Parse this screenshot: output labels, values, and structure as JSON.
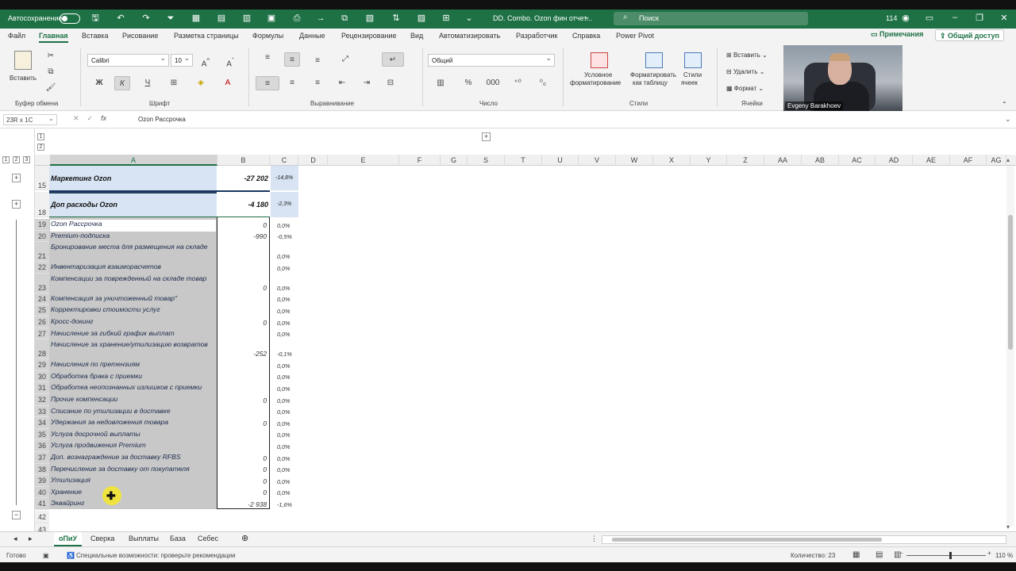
{
  "titlebar": {
    "autosave_label": "Автосохранение",
    "file_name": "DD. Combo. Ozon фин отчет...",
    "search_placeholder": "Поиск",
    "user_count": "114"
  },
  "ribbon_tabs": [
    "Файл",
    "Главная",
    "Вставка",
    "Рисование",
    "Разметка страницы",
    "Формулы",
    "Данные",
    "Рецензирование",
    "Вид",
    "Автоматизировать",
    "Разработчик",
    "Справка",
    "Power Pivot"
  ],
  "ribbon_right": {
    "notes": "Примечания",
    "share": "Общий доступ"
  },
  "ribbon": {
    "paste": "Вставить",
    "clipboard": "Буфер обмена",
    "font_name": "Calibri",
    "font_size": "10",
    "font_group": "Шрифт",
    "bold": "Ж",
    "italic": "К",
    "underline": "Ч",
    "alignment_group": "Выравнивание",
    "number_format": "Общий",
    "number_group": "Число",
    "cond_format_1": "Условное",
    "cond_format_2": "форматирование",
    "format_table_1": "Форматировать",
    "format_table_2": "как таблицу",
    "styles_1": "Стили",
    "styles_2": "ячеек",
    "styles_group": "Стили",
    "insert_cells": "Вставить",
    "delete_cells": "Удалить",
    "format_cells": "Формат",
    "cells_group": "Ячейки"
  },
  "video": {
    "name": "Evgeny Barakhoev"
  },
  "formula_bar": {
    "name_box": "23R x 1C",
    "fx": "fx",
    "value": "Ozon Рассрочка"
  },
  "outline_levels": [
    "1",
    "2",
    "3"
  ],
  "column_headers": [
    "A",
    "B",
    "C",
    "D",
    "E",
    "F",
    "G",
    "S",
    "T",
    "U",
    "V",
    "W",
    "X",
    "Y",
    "Z",
    "AA",
    "AB",
    "AC",
    "AD",
    "AE",
    "AF",
    "AG"
  ],
  "header_rows": [
    {
      "row": "15",
      "label": "Маркетинг Ozon",
      "b": "-27 202",
      "c": "-14,8%"
    },
    {
      "row": "18",
      "label": "Доп расходы Ozon",
      "b": "-4 180",
      "c": "-2,3%"
    }
  ],
  "rows": [
    {
      "row": "19",
      "label": "Ozon Рассрочка",
      "b": "0",
      "c": "0,0%"
    },
    {
      "row": "20",
      "label": "Premium-подписка",
      "b": "-990",
      "c": "-0,5%"
    },
    {
      "row": "21",
      "label": "Бронирование места для размещения на складе",
      "b": "",
      "c": "0,0%"
    },
    {
      "row": "22",
      "label": "Инвентаризация взаиморасчетов",
      "b": "",
      "c": "0,0%"
    },
    {
      "row": "23",
      "label": "Компенсации за поврежденный на складе товар",
      "b": "0",
      "c": "0,0%"
    },
    {
      "row": "24",
      "label": "Компенсация за уничтоженный товар\"",
      "b": "",
      "c": "0,0%"
    },
    {
      "row": "25",
      "label": "Корректировки стоимости услуг",
      "b": "",
      "c": "0,0%"
    },
    {
      "row": "26",
      "label": "Кросс-докинг",
      "b": "0",
      "c": "0,0%"
    },
    {
      "row": "27",
      "label": "Начисление за гибкий график выплат",
      "b": "",
      "c": "0,0%"
    },
    {
      "row": "28",
      "label": "Начисление за хранение/утилизацию возвратов",
      "b": "-252",
      "c": "-0,1%"
    },
    {
      "row": "29",
      "label": "Начисления по претензиям",
      "b": "",
      "c": "0,0%"
    },
    {
      "row": "30",
      "label": "Обработка брака с приемки",
      "b": "",
      "c": "0,0%"
    },
    {
      "row": "31",
      "label": "Обработка неопознанных излишков с приемки",
      "b": "",
      "c": "0,0%"
    },
    {
      "row": "32",
      "label": "Прочие компенсации",
      "b": "0",
      "c": "0,0%"
    },
    {
      "row": "33",
      "label": "Списание по утилизации в доставке",
      "b": "",
      "c": "0,0%"
    },
    {
      "row": "34",
      "label": "Удержания за недовложения товара",
      "b": "0",
      "c": "0,0%"
    },
    {
      "row": "35",
      "label": "Услуга досрочной выплаты",
      "b": "",
      "c": "0,0%"
    },
    {
      "row": "36",
      "label": "Услуга продвижения Premium",
      "b": "",
      "c": "0,0%"
    },
    {
      "row": "37",
      "label": "Доп. вознаграждение за доставку RFBS",
      "b": "0",
      "c": "0,0%"
    },
    {
      "row": "38",
      "label": "Перечисление за доставку от покупателя",
      "b": "0",
      "c": "0,0%"
    },
    {
      "row": "39",
      "label": "Утилизация",
      "b": "0",
      "c": "0,0%"
    },
    {
      "row": "40",
      "label": "Хранение",
      "b": "0",
      "c": "0,0%"
    },
    {
      "row": "41",
      "label": "Эквайринг",
      "b": "-2 938",
      "c": "-1,6%"
    }
  ],
  "extra_row_headers": [
    "42",
    "43"
  ],
  "sheet_tabs": [
    "оПиУ",
    "Сверка",
    "Выплаты",
    "База",
    "Себес"
  ],
  "status": {
    "ready": "Готово",
    "accessibility": "Специальные возможности: проверьте рекомендации",
    "count": "Количество: 23",
    "zoom": "110 %"
  }
}
